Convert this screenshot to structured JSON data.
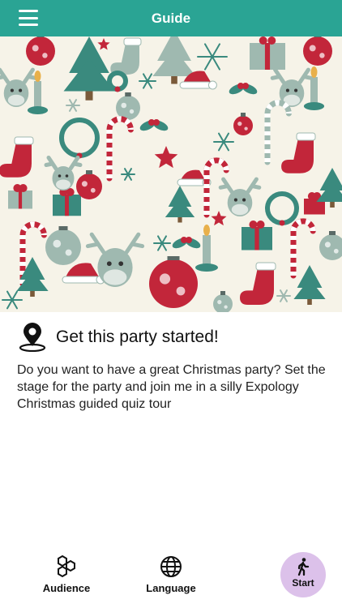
{
  "header": {
    "title": "Guide"
  },
  "intro": {
    "title": "Get this party started!",
    "description": "Do you want to have a great Christmas party? Set the stage for the party and join me in a silly Expology Christmas guided quiz tour"
  },
  "tabbar": {
    "audience_label": "Audience",
    "language_label": "Language",
    "start_label": "Start"
  },
  "colors": {
    "header": "#2aa494",
    "pattern_bg": "#f6f3e8",
    "pattern_red": "#c2263a",
    "pattern_teal": "#3a8a7e",
    "pattern_sage": "#9fb9b0",
    "start_button": "#dcc1ea"
  },
  "icons": [
    "menu-icon",
    "location-pin-icon",
    "hexagons-icon",
    "globe-icon",
    "walking-person-icon"
  ]
}
